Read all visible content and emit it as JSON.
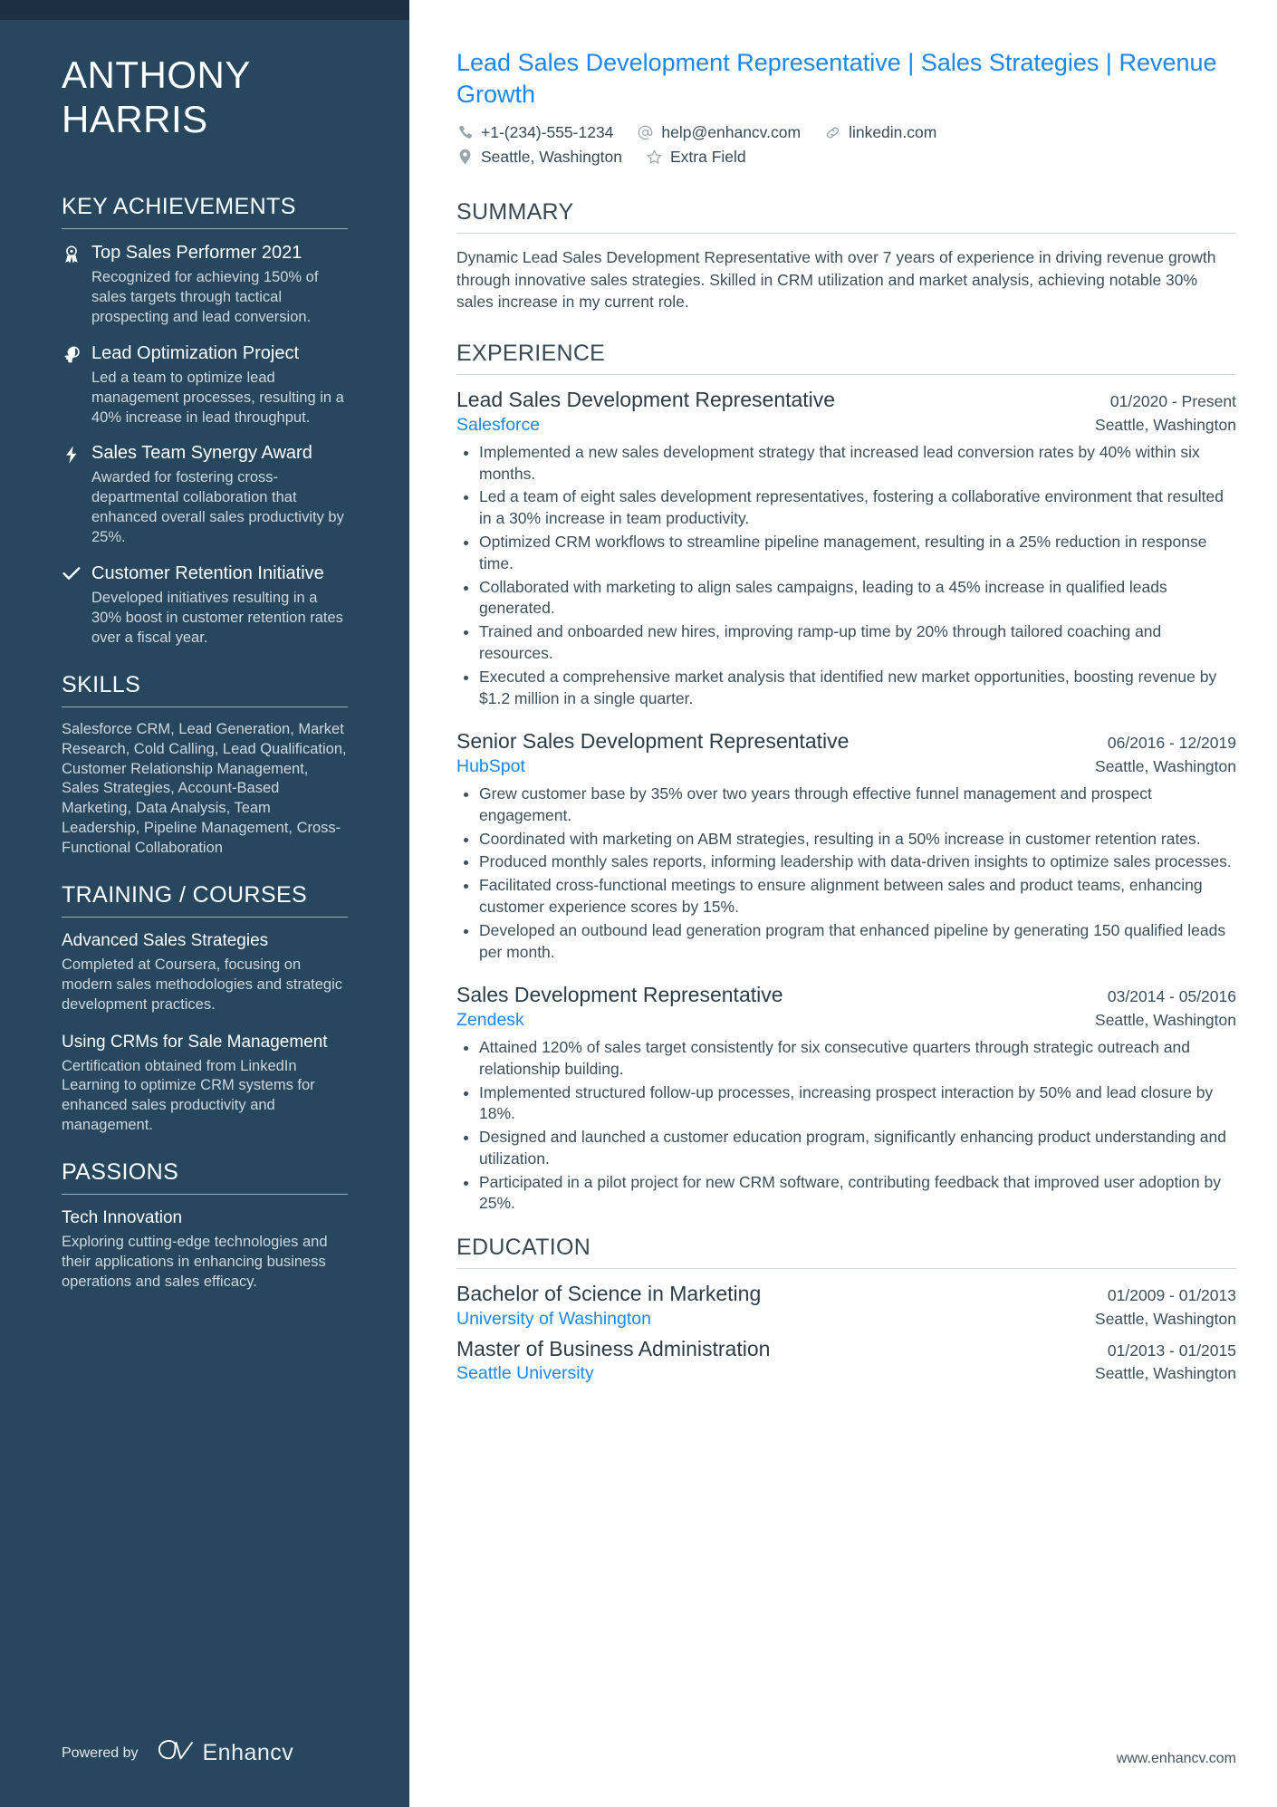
{
  "colors": {
    "sidebar_bg": "#27475f",
    "sidebar_top_strip": "#1c3042",
    "accent_blue": "#1a87f5",
    "body_text": "#3e4f5a"
  },
  "sidebar": {
    "name_lines": [
      "ANTHONY",
      "HARRIS"
    ],
    "sections": {
      "key_achievements": {
        "heading": "KEY ACHIEVEMENTS",
        "items": [
          {
            "icon": "award-ribbon-icon",
            "title": "Top Sales Performer 2021",
            "description": "Recognized for achieving 150% of sales targets through tactical prospecting and lead conversion."
          },
          {
            "icon": "lightbulb-head-icon",
            "title": "Lead Optimization Project",
            "description": "Led a team to optimize lead management processes, resulting in a 40% increase in lead throughput."
          },
          {
            "icon": "lightning-bolt-icon",
            "title": "Sales Team Synergy Award",
            "description": "Awarded for fostering cross-departmental collaboration that enhanced overall sales productivity by 25%."
          },
          {
            "icon": "checkmark-icon",
            "title": "Customer Retention Initiative",
            "description": "Developed initiatives resulting in a 30% boost in customer retention rates over a fiscal year."
          }
        ]
      },
      "skills": {
        "heading": "SKILLS",
        "text": "Salesforce CRM, Lead Generation, Market Research, Cold Calling, Lead Qualification, Customer Relationship Management, Sales Strategies, Account-Based Marketing, Data Analysis, Team Leadership, Pipeline Management, Cross-Functional Collaboration"
      },
      "training": {
        "heading": "TRAINING / COURSES",
        "items": [
          {
            "title": "Advanced Sales Strategies",
            "description": "Completed at Coursera, focusing on modern sales methodologies and strategic development practices."
          },
          {
            "title": "Using CRMs for Sale Management",
            "description": "Certification obtained from LinkedIn Learning to optimize CRM systems for enhanced sales productivity and management."
          }
        ]
      },
      "passions": {
        "heading": "PASSIONS",
        "items": [
          {
            "title": "Tech Innovation",
            "description": "Exploring cutting-edge technologies and their applications in enhancing business operations and sales efficacy."
          }
        ]
      }
    },
    "footer": {
      "powered_by": "Powered by",
      "brand": "Enhancv"
    }
  },
  "main": {
    "headline": "Lead Sales Development Representative | Sales Strategies | Revenue Growth",
    "contact": {
      "row1": [
        {
          "icon": "phone-icon",
          "value": "+1-(234)-555-1234"
        },
        {
          "icon": "at-sign-icon",
          "value": "help@enhancv.com"
        },
        {
          "icon": "link-icon",
          "value": "linkedin.com"
        }
      ],
      "row2": [
        {
          "icon": "map-pin-icon",
          "value": "Seattle, Washington"
        },
        {
          "icon": "star-icon",
          "value": "Extra Field"
        }
      ]
    },
    "summary": {
      "heading": "SUMMARY",
      "text": "Dynamic Lead Sales Development Representative with over 7 years of experience in driving revenue growth through innovative sales strategies. Skilled in CRM utilization and market analysis, achieving notable 30% sales increase in my current role."
    },
    "experience": {
      "heading": "EXPERIENCE",
      "entries": [
        {
          "title": "Lead Sales Development Representative",
          "date": "01/2020 - Present",
          "company": "Salesforce",
          "location": "Seattle, Washington",
          "bullets": [
            "Implemented a new sales development strategy that increased lead conversion rates by 40% within six months.",
            "Led a team of eight sales development representatives, fostering a collaborative environment that resulted in a 30% increase in team productivity.",
            "Optimized CRM workflows to streamline pipeline management, resulting in a 25% reduction in response time.",
            "Collaborated with marketing to align sales campaigns, leading to a 45% increase in qualified leads generated.",
            "Trained and onboarded new hires, improving ramp-up time by 20% through tailored coaching and resources.",
            "Executed a comprehensive market analysis that identified new market opportunities, boosting revenue by $1.2 million in a single quarter."
          ]
        },
        {
          "title": "Senior Sales Development Representative",
          "date": "06/2016 - 12/2019",
          "company": "HubSpot",
          "location": "Seattle, Washington",
          "bullets": [
            "Grew customer base by 35% over two years through effective funnel management and prospect engagement.",
            "Coordinated with marketing on ABM strategies, resulting in a 50% increase in customer retention rates.",
            "Produced monthly sales reports, informing leadership with data-driven insights to optimize sales processes.",
            "Facilitated cross-functional meetings to ensure alignment between sales and product teams, enhancing customer experience scores by 15%.",
            "Developed an outbound lead generation program that enhanced pipeline by generating 150 qualified leads per month."
          ]
        },
        {
          "title": "Sales Development Representative",
          "date": "03/2014 - 05/2016",
          "company": "Zendesk",
          "location": "Seattle, Washington",
          "bullets": [
            "Attained 120% of sales target consistently for six consecutive quarters through strategic outreach and relationship building.",
            "Implemented structured follow-up processes, increasing prospect interaction by 50% and lead closure by 18%.",
            "Designed and launched a customer education program, significantly enhancing product understanding and utilization.",
            "Participated in a pilot project for new CRM software, contributing feedback that improved user adoption by 25%."
          ]
        }
      ]
    },
    "education": {
      "heading": "EDUCATION",
      "entries": [
        {
          "title": "Bachelor of Science in Marketing",
          "date": "01/2009 - 01/2013",
          "school": "University of Washington",
          "location": "Seattle, Washington"
        },
        {
          "title": "Master of Business Administration",
          "date": "01/2013 - 01/2015",
          "school": "Seattle University",
          "location": "Seattle, Washington"
        }
      ]
    },
    "footer_url": "www.enhancv.com"
  }
}
